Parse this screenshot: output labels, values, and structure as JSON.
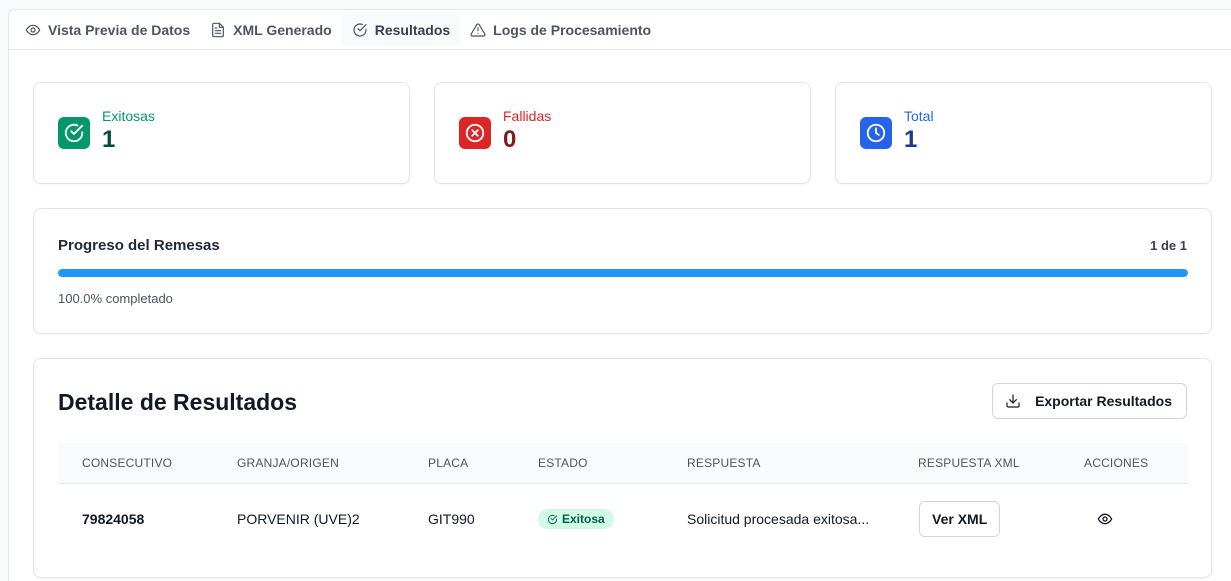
{
  "tabs": [
    {
      "label": "Vista Previa de Datos",
      "icon": "eye-icon"
    },
    {
      "label": "XML Generado",
      "icon": "file-text-icon"
    },
    {
      "label": "Resultados",
      "icon": "check-circle-icon",
      "active": true
    },
    {
      "label": "Logs de Procesamiento",
      "icon": "warning-triangle-icon"
    }
  ],
  "stats": {
    "success": {
      "label": "Exitosas",
      "value": "1",
      "color": "#059669",
      "icon": "check-circle-icon"
    },
    "failed": {
      "label": "Fallidas",
      "value": "0",
      "color": "#dc2626",
      "icon": "x-circle-icon"
    },
    "total": {
      "label": "Total",
      "value": "1",
      "color": "#2563eb",
      "icon": "clock-icon"
    }
  },
  "progress": {
    "title": "Progreso del Remesas",
    "count": "1 de 1",
    "fraction": 1.0,
    "note": "100.0% completado",
    "color": "#2196f3"
  },
  "results": {
    "title": "Detalle de Resultados",
    "export_label": "Exportar Resultados",
    "columns": [
      "CONSECUTIVO",
      "GRANJA/ORIGEN",
      "PLACA",
      "ESTADO",
      "RESPUESTA",
      "RESPUESTA XML",
      "ACCIONES"
    ],
    "rows": [
      {
        "consecutivo": "79824058",
        "granja": "PORVENIR (UVE)2",
        "placa": "GIT990",
        "estado": "Exitosa",
        "respuesta": "Solicitud procesada exitosa...",
        "xml_button": "Ver XML",
        "action_icon": "eye-icon"
      }
    ]
  }
}
